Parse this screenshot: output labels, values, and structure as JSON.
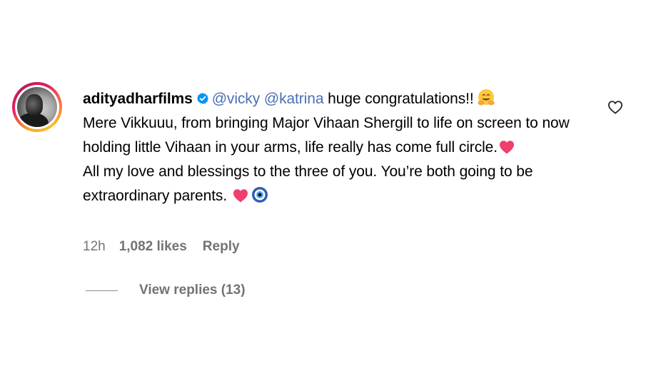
{
  "comment": {
    "username": "adityadharfilms",
    "mention_1": "@vicky",
    "mention_2": "@katrina",
    "text_start": " huge congratulations!!",
    "line_2": "Mere Vikkuuu, from bringing Major Vihaan Shergill to life on screen to now holding little Vihaan in your arms, life really has come full circle.",
    "line_3": "All my love and blessings to the three of you. You’re both going to be extraordinary parents.",
    "time": "12h",
    "likes": "1,082 likes",
    "reply_label": "Reply",
    "view_replies": "View replies (13)"
  },
  "colors": {
    "mention": "#4a6fb3",
    "meta": "#737373",
    "verified": "#0095f6",
    "heart": "#ee3f6d"
  },
  "icons": {
    "verified": "verified-badge-icon",
    "like": "heart-outline-icon",
    "emoji_hug": "hugging-face-emoji",
    "emoji_heart": "pink-heart-emoji",
    "emoji_eye": "nazar-amulet-emoji"
  }
}
